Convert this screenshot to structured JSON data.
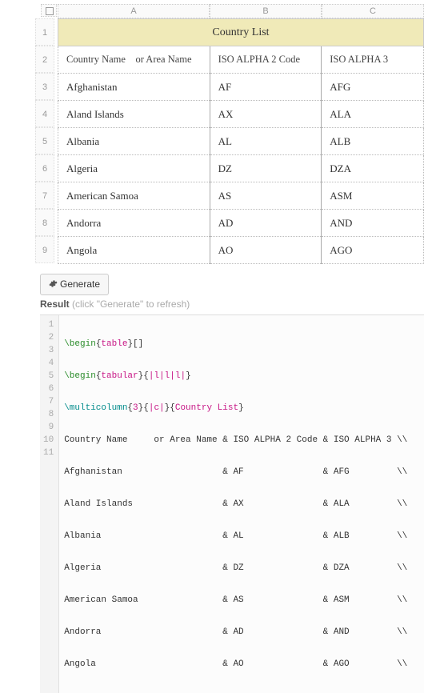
{
  "sheet": {
    "columns": [
      "A",
      "B",
      "C"
    ],
    "row_numbers": [
      "1",
      "2",
      "3",
      "4",
      "5",
      "6",
      "7",
      "8",
      "9"
    ],
    "title": "Country List",
    "headers": {
      "col1_line1": "Country Name",
      "col1_line2": "or Area Name",
      "col2": "ISO ALPHA 2 Code",
      "col3": "ISO ALPHA 3"
    },
    "rows": [
      {
        "name": "Afghanistan",
        "a2": "AF",
        "a3": "AFG"
      },
      {
        "name": "Aland Islands",
        "a2": "AX",
        "a3": "ALA"
      },
      {
        "name": "Albania",
        "a2": "AL",
        "a3": "ALB"
      },
      {
        "name": "Algeria",
        "a2": "DZ",
        "a3": "DZA"
      },
      {
        "name": "American Samoa",
        "a2": "AS",
        "a3": "ASM"
      },
      {
        "name": "Andorra",
        "a2": "AD",
        "a3": "AND"
      },
      {
        "name": "Angola",
        "a2": "AO",
        "a3": "AGO"
      }
    ]
  },
  "button": {
    "icon": "gear-icon",
    "label": "Generate"
  },
  "result": {
    "label": "Result",
    "hint": "(click \"Generate\" to refresh)"
  },
  "code": {
    "gutter": [
      "1",
      "2",
      "3",
      "4",
      "5",
      "6",
      "7",
      "8",
      "9",
      "10",
      "11"
    ],
    "lines": {
      "l1": "\\begin{table}[]",
      "l2": "\\begin{tabular}{|l|l|l|}",
      "l3": {
        "cmd": "\\multicolumn",
        "n": "3",
        "spec": "|c|",
        "text": "Country List",
        "tail": "                                         \\\\"
      },
      "l4": "Country Name     or Area Name & ISO ALPHA 2 Code & ISO ALPHA 3 \\\\",
      "l5": "Afghanistan                   & AF               & AFG         \\\\",
      "l6": "Aland Islands                 & AX               & ALA         \\\\",
      "l7": "Albania                       & AL               & ALB         \\\\",
      "l8": "Algeria                       & DZ               & DZA         \\\\",
      "l9": "American Samoa                & AS               & ASM         \\\\",
      "l10": "Andorra                       & AD               & AND         \\\\",
      "l11": "Angola                        & AO               & AGO         \\\\"
    }
  }
}
